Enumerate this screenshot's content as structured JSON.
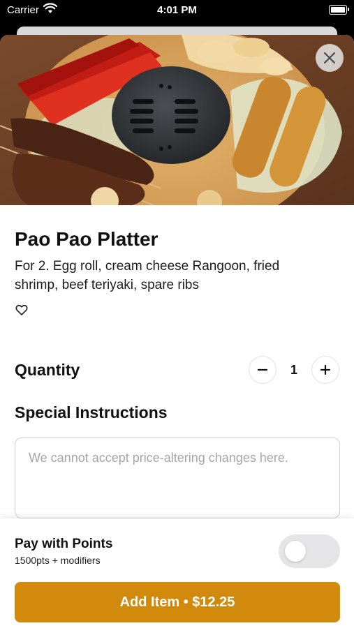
{
  "status_bar": {
    "carrier": "Carrier",
    "time": "4:01 PM"
  },
  "item": {
    "title": "Pao Pao Platter",
    "description": "For 2. Egg roll, cream cheese Rangoon, fried shrimp, beef teriyaki, spare ribs"
  },
  "quantity": {
    "label": "Quantity",
    "value": "1"
  },
  "instructions": {
    "label": "Special Instructions",
    "placeholder": "We cannot accept price-altering changes here.",
    "value": ""
  },
  "points": {
    "title": "Pay with Points",
    "subtitle": "1500pts + modifiers",
    "enabled": false
  },
  "add_button": {
    "label": "Add Item • $12.25"
  },
  "colors": {
    "accent": "#d18a0b",
    "toggle_off": "#e5e5e7"
  },
  "icons": [
    "wifi-icon",
    "battery-icon",
    "close-icon",
    "heart-icon",
    "minus-icon",
    "plus-icon"
  ]
}
